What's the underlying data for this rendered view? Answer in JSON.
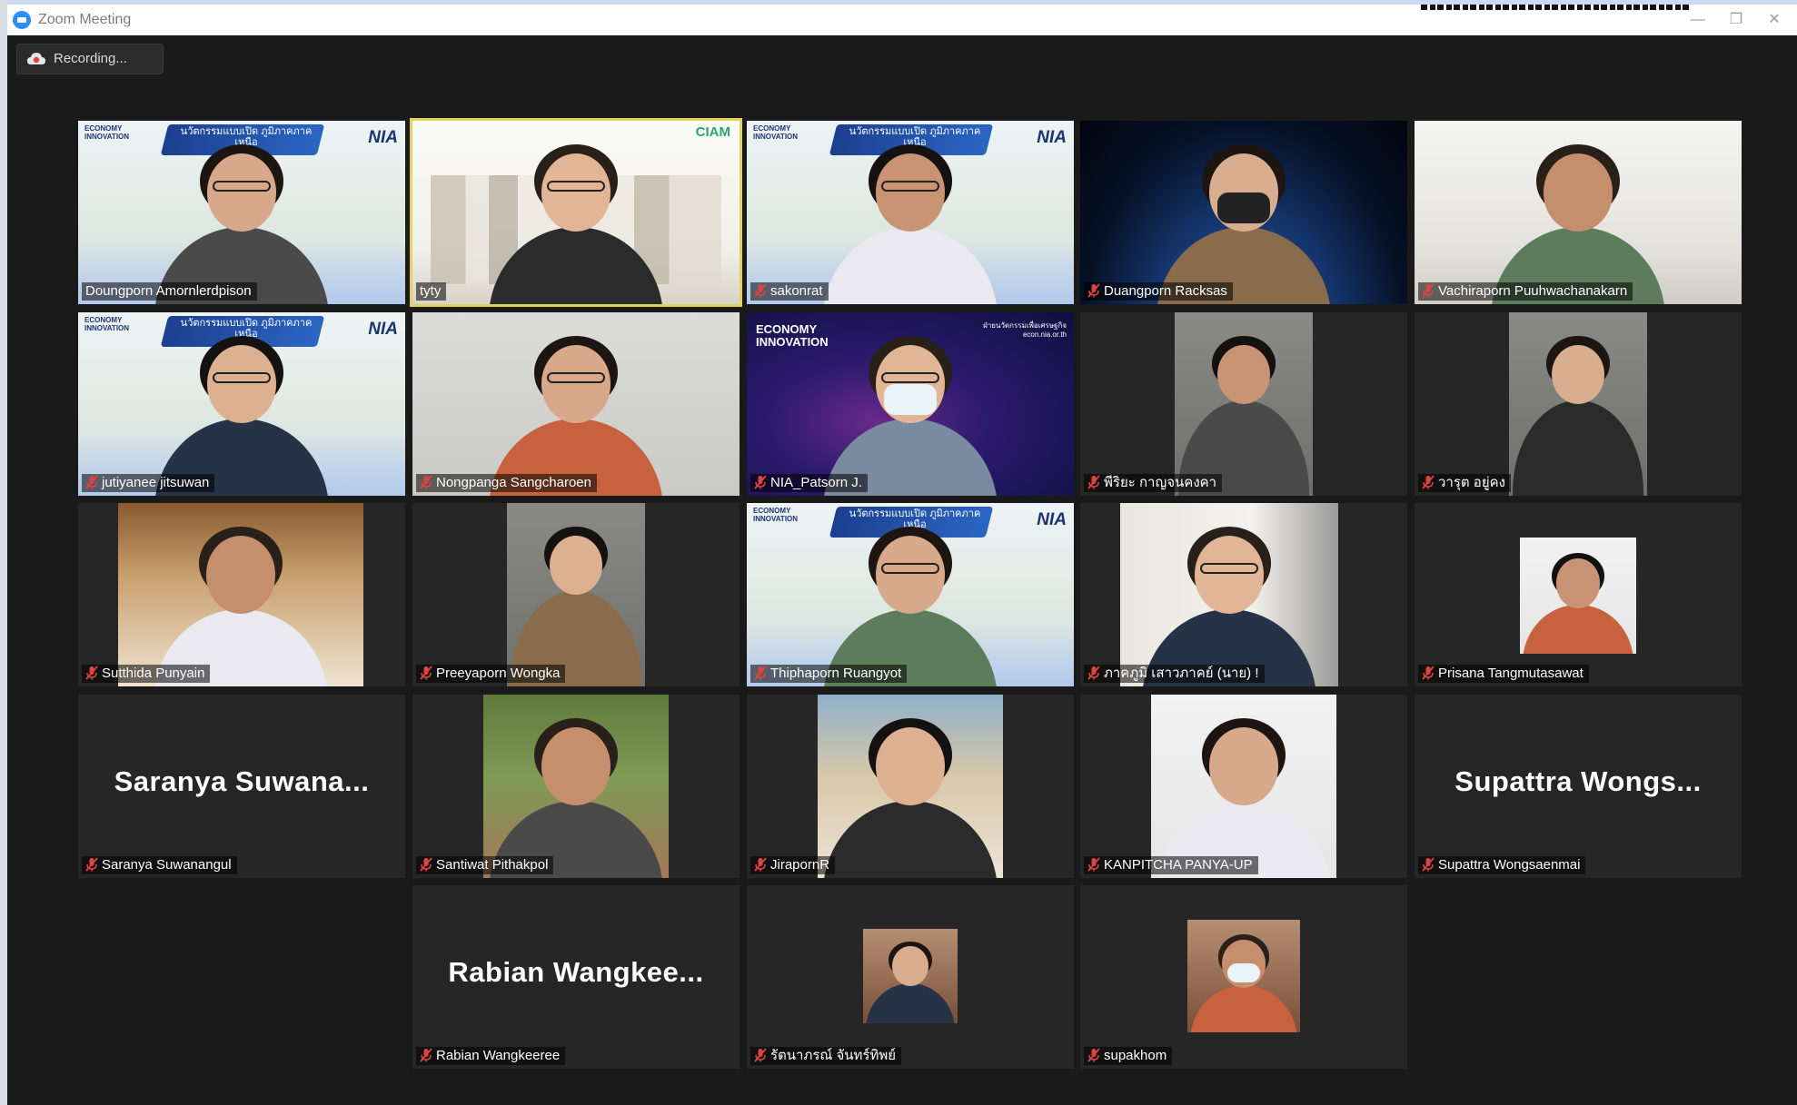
{
  "window": {
    "title": "Zoom Meeting",
    "minimize_glyph": "—",
    "restore_glyph": "❐",
    "close_glyph": "✕"
  },
  "recording": {
    "label": "Recording...",
    "icon": "cloud-recording-icon"
  },
  "participants": [
    {
      "name": "Doungporn Amornlerdpison",
      "muted": false,
      "video": true,
      "background": "nia-banner"
    },
    {
      "name": "tyty",
      "muted": false,
      "video": true,
      "active_speaker": true,
      "background": "city-illustration"
    },
    {
      "name": "sakonrat",
      "muted": true,
      "video": true,
      "background": "nia-banner"
    },
    {
      "name": "Duangporn Racksas",
      "muted": true,
      "video": true,
      "background": "earth-space"
    },
    {
      "name": "Vachiraporn Puuhwachanakarn",
      "muted": true,
      "video": true,
      "background": "office"
    },
    {
      "name": "jutiyanee jitsuwan",
      "muted": true,
      "video": true,
      "background": "nia-banner"
    },
    {
      "name": "Nongpanga Sangcharoen",
      "muted": true,
      "video": true,
      "background": "plain-wall"
    },
    {
      "name": "NIA_Patsorn J.",
      "muted": true,
      "video": true,
      "background": "economy-innovation-network"
    },
    {
      "name": "พีริยะ กาญจนคงคา",
      "muted": true,
      "video": true,
      "background": "none"
    },
    {
      "name": "วารุต อยู่คง",
      "muted": true,
      "video": true,
      "background": "none"
    },
    {
      "name": "Sutthida Punyain",
      "muted": true,
      "video": true,
      "background": "wood-interior"
    },
    {
      "name": "Preeyaporn Wongka",
      "muted": true,
      "video": true,
      "background": "none"
    },
    {
      "name": "Thiphaporn Ruangyot",
      "muted": true,
      "video": true,
      "background": "nia-banner"
    },
    {
      "name": "ภาคภูมิ เสาวภาคย์ (นาย) !",
      "muted": true,
      "video": true,
      "background": "office-wall"
    },
    {
      "name": "Prisana Tangmutasawat",
      "muted": true,
      "video": true,
      "background": "portrait-photo"
    },
    {
      "name": "Saranya Suwanangul",
      "muted": true,
      "video": false,
      "display_name": "Saranya  Suwana..."
    },
    {
      "name": "Santiwat Pithakpol",
      "muted": true,
      "video": true,
      "background": "garden-photo"
    },
    {
      "name": "JirapornR",
      "muted": true,
      "video": true,
      "background": "house-photo"
    },
    {
      "name": "KANPITCHA PANYA-UP",
      "muted": true,
      "video": true,
      "background": "portrait-photo"
    },
    {
      "name": "Supattra Wongsaenmai",
      "muted": true,
      "video": false,
      "display_name": "Supattra  Wongs..."
    },
    {
      "name": "Rabian Wangkeeree",
      "muted": true,
      "video": false,
      "display_name": "Rabian  Wangkee..."
    },
    {
      "name": "รัตนาภรณ์ จันทร์ทิพย์",
      "muted": true,
      "video": true,
      "background": "profile-photo"
    },
    {
      "name": "supakhom",
      "muted": true,
      "video": true,
      "background": "profile-photo"
    }
  ],
  "brand": {
    "economy_innovation": "ECONOMY INNOVATION",
    "banner_text": "นวัตกรรมแบบเปิด ภูมิภาคภาคเหนือ",
    "nia": "NIA",
    "network_caption": "ฝ่ายนวัตกรรมเพื่อเศรษฐกิจ econ.nia.or.th",
    "ciam": "CIAM"
  },
  "colors": {
    "meeting_bg": "#1a1a1a",
    "tile_bg": "#262626",
    "active_speaker_border": "#e0d25a",
    "muted_icon": "#e0443e",
    "zoom_blue": "#2d8cff"
  }
}
